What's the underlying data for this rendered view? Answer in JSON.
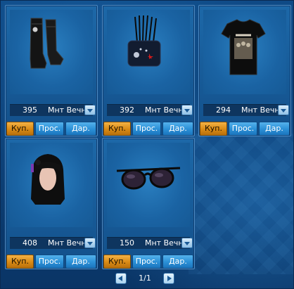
{
  "items": [
    {
      "name_icon": "boots-icon",
      "price": "395",
      "currency": "Мнт Вечн",
      "buy_label": "Куп.",
      "view_label": "Прос.",
      "gift_label": "Дар."
    },
    {
      "name_icon": "bag-icon",
      "price": "392",
      "currency": "Мнт Вечн",
      "buy_label": "Куп.",
      "view_label": "Прос.",
      "gift_label": "Дар."
    },
    {
      "name_icon": "tshirt-icon",
      "price": "294",
      "currency": "Мнт Вечн",
      "buy_label": "Куп.",
      "view_label": "Прос.",
      "gift_label": "Дар."
    },
    {
      "name_icon": "hairstyle-icon",
      "price": "408",
      "currency": "Мнт Вечн",
      "buy_label": "Куп.",
      "view_label": "Прос.",
      "gift_label": "Дар."
    },
    {
      "name_icon": "sunglasses-icon",
      "price": "150",
      "currency": "Мнт Вечн",
      "buy_label": "Куп.",
      "view_label": "Прос.",
      "gift_label": "Дар."
    }
  ],
  "pager": {
    "text": "1/1"
  },
  "colors": {
    "buy": "#d98a15",
    "action": "#2a8fd6",
    "panel": "#0f4a86"
  }
}
